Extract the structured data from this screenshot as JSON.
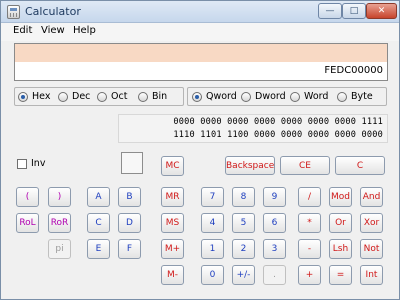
{
  "window": {
    "title": "Calculator"
  },
  "menu": [
    "Edit",
    "View",
    "Help"
  ],
  "display": {
    "value": "FEDC00000"
  },
  "number_system": {
    "options": [
      "Hex",
      "Dec",
      "Oct",
      "Bin"
    ],
    "selected": "Hex"
  },
  "word_size": {
    "options": [
      "Qword",
      "Dword",
      "Word",
      "Byte"
    ],
    "selected": "Qword"
  },
  "binary": {
    "line1": "0000 0000 0000 0000 0000 0000 0000 1111",
    "line2": "1110 1101 1100 0000 0000 0000 0000 0000"
  },
  "inv": {
    "label": "Inv",
    "checked": false
  },
  "buttons": {
    "lparen": "(",
    "rparen": ")",
    "rol": "RoL",
    "ror": "RoR",
    "pi": "pi",
    "a": "A",
    "b": "B",
    "c": "C",
    "d": "D",
    "e": "E",
    "f": "F",
    "mc": "MC",
    "mr": "MR",
    "ms": "MS",
    "mplus": "M+",
    "mminus": "M-",
    "backspace": "Backspace",
    "ce": "CE",
    "clear": "C",
    "n7": "7",
    "n8": "8",
    "n9": "9",
    "n4": "4",
    "n5": "5",
    "n6": "6",
    "n1": "1",
    "n2": "2",
    "n3": "3",
    "n0": "0",
    "plusminus": "+/-",
    "dot": ".",
    "div": "/",
    "mul": "*",
    "sub": "-",
    "add": "+",
    "eq": "=",
    "mod": "Mod",
    "and": "And",
    "or": "Or",
    "xor": "Xor",
    "lsh": "Lsh",
    "not": "Not",
    "int": "Int"
  },
  "colors": {
    "accent_red": "#d01818",
    "accent_blue": "#1f3fbf",
    "accent_magenta": "#b000b0",
    "display_band": "#f8d9c4"
  }
}
